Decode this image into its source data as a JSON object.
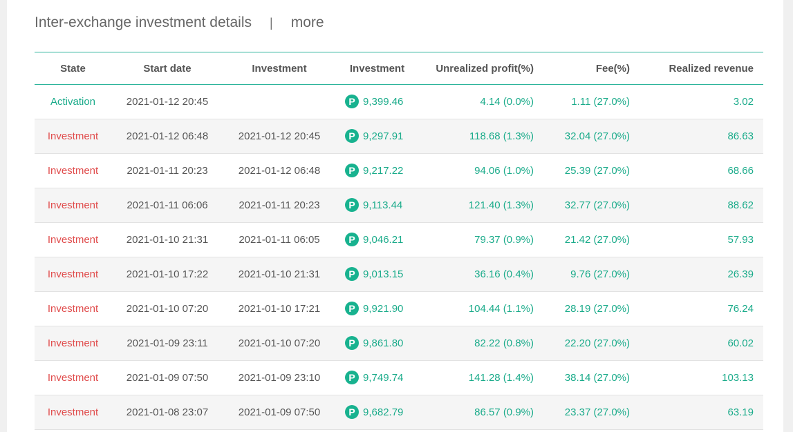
{
  "header": {
    "title": "Inter-exchange investment details",
    "separator": "|",
    "more": "more"
  },
  "columns": {
    "state": "State",
    "start_date": "Start date",
    "investment_date": "Investment",
    "investment": "Investment",
    "unrealized": "Unrealized profit(%)",
    "fee": "Fee(%)",
    "realized": "Realized revenue"
  },
  "coin_icon": {
    "name": "coin-p-icon",
    "glyph": "P",
    "color": "#18b28f"
  },
  "colors": {
    "accent": "#1aab8a",
    "investment_state": "#e04b4b",
    "activation_state": "#1aab8a"
  },
  "rows": [
    {
      "state": "Activation",
      "start": "2021-01-12 20:45",
      "end": "",
      "amount": "9,399.46",
      "unrealized": "4.14 (0.0%)",
      "fee": "1.11 (27.0%)",
      "realized": "3.02"
    },
    {
      "state": "Investment",
      "start": "2021-01-12 06:48",
      "end": "2021-01-12 20:45",
      "amount": "9,297.91",
      "unrealized": "118.68 (1.3%)",
      "fee": "32.04 (27.0%)",
      "realized": "86.63"
    },
    {
      "state": "Investment",
      "start": "2021-01-11 20:23",
      "end": "2021-01-12 06:48",
      "amount": "9,217.22",
      "unrealized": "94.06 (1.0%)",
      "fee": "25.39 (27.0%)",
      "realized": "68.66"
    },
    {
      "state": "Investment",
      "start": "2021-01-11 06:06",
      "end": "2021-01-11 20:23",
      "amount": "9,113.44",
      "unrealized": "121.40 (1.3%)",
      "fee": "32.77 (27.0%)",
      "realized": "88.62"
    },
    {
      "state": "Investment",
      "start": "2021-01-10 21:31",
      "end": "2021-01-11 06:05",
      "amount": "9,046.21",
      "unrealized": "79.37 (0.9%)",
      "fee": "21.42 (27.0%)",
      "realized": "57.93"
    },
    {
      "state": "Investment",
      "start": "2021-01-10 17:22",
      "end": "2021-01-10 21:31",
      "amount": "9,013.15",
      "unrealized": "36.16 (0.4%)",
      "fee": "9.76 (27.0%)",
      "realized": "26.39"
    },
    {
      "state": "Investment",
      "start": "2021-01-10 07:20",
      "end": "2021-01-10 17:21",
      "amount": "9,921.90",
      "unrealized": "104.44 (1.1%)",
      "fee": "28.19 (27.0%)",
      "realized": "76.24"
    },
    {
      "state": "Investment",
      "start": "2021-01-09 23:11",
      "end": "2021-01-10 07:20",
      "amount": "9,861.80",
      "unrealized": "82.22 (0.8%)",
      "fee": "22.20 (27.0%)",
      "realized": "60.02"
    },
    {
      "state": "Investment",
      "start": "2021-01-09 07:50",
      "end": "2021-01-09 23:10",
      "amount": "9,749.74",
      "unrealized": "141.28 (1.4%)",
      "fee": "38.14 (27.0%)",
      "realized": "103.13"
    },
    {
      "state": "Investment",
      "start": "2021-01-08 23:07",
      "end": "2021-01-09 07:50",
      "amount": "9,682.79",
      "unrealized": "86.57 (0.9%)",
      "fee": "23.37 (27.0%)",
      "realized": "63.19"
    }
  ]
}
